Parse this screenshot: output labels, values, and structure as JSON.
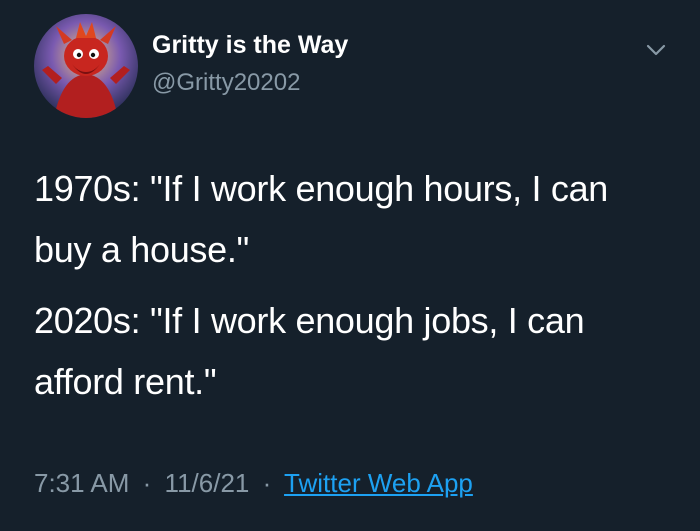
{
  "author": {
    "display_name": "Gritty is the Way",
    "handle": "@Gritty20202",
    "avatar_icon": "avatar-image"
  },
  "menu_icon": "chevron-down-icon",
  "tweet": {
    "line1": "1970s: \"If I work enough hours, I can buy a house.\"",
    "line2": "2020s: \"If I work enough jobs, I can afford rent.\""
  },
  "meta": {
    "time": "7:31 AM",
    "date": "11/6/21",
    "separator": "·",
    "source": "Twitter Web App"
  },
  "colors": {
    "background": "#15202b",
    "text": "#ffffff",
    "secondary": "#8899a6",
    "link": "#1da1f2"
  }
}
